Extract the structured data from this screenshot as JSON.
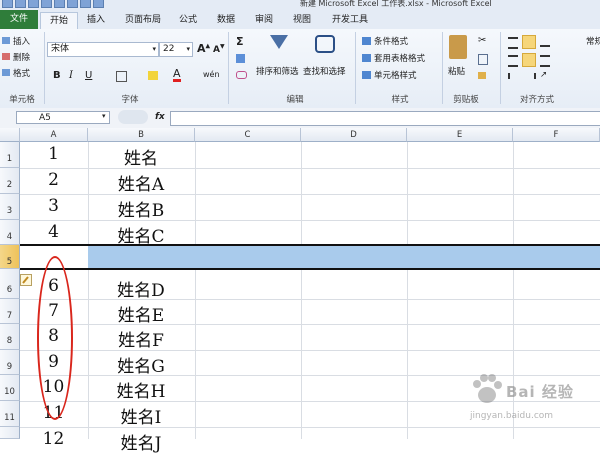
{
  "window": {
    "title": "新建 Microsoft Excel 工作表.xlsx - Microsoft Excel"
  },
  "tabs": [
    {
      "label": "文件"
    },
    {
      "label": "开始"
    },
    {
      "label": "插入"
    },
    {
      "label": "页面布局"
    },
    {
      "label": "公式"
    },
    {
      "label": "数据"
    },
    {
      "label": "审阅"
    },
    {
      "label": "视图"
    },
    {
      "label": "开发工具"
    }
  ],
  "ribbon": {
    "cells_group": {
      "insert": "插入",
      "delete": "删除",
      "format": "格式",
      "label": "单元格"
    },
    "font_group": {
      "font_name": "宋体",
      "font_size": "22",
      "label": "字体",
      "phonetic": "wén"
    },
    "editing_group": {
      "sort_filter": "排序和筛选",
      "find_select": "查找和选择",
      "label": "编辑"
    },
    "styles_group": {
      "conditional": "条件格式",
      "table_format": "套用表格格式",
      "cell_styles": "单元格样式",
      "label": "样式"
    },
    "clipboard_group": {
      "paste": "粘贴",
      "label": "剪贴板"
    },
    "alignment_group": {
      "wrap": "常规",
      "label": "对齐方式"
    }
  },
  "formula_bar": {
    "name_box": "A5",
    "fx": "fx",
    "formula": ""
  },
  "sheet": {
    "columns": [
      "A",
      "B",
      "C",
      "D",
      "E",
      "F"
    ],
    "rows": [
      {
        "num": "1",
        "a": "1",
        "b": "姓名"
      },
      {
        "num": "2",
        "a": "2",
        "b": "姓名A"
      },
      {
        "num": "3",
        "a": "3",
        "b": "姓名B"
      },
      {
        "num": "4",
        "a": "4",
        "b": "姓名C"
      },
      {
        "num": "5",
        "a": "",
        "b": ""
      },
      {
        "num": "6",
        "a": "6",
        "b": "姓名D"
      },
      {
        "num": "7",
        "a": "7",
        "b": "姓名E"
      },
      {
        "num": "8",
        "a": "8",
        "b": "姓名F"
      },
      {
        "num": "9",
        "a": "9",
        "b": "姓名G"
      },
      {
        "num": "10",
        "a": "10",
        "b": "姓名H"
      },
      {
        "num": "11",
        "a": "11",
        "b": "姓名I"
      },
      {
        "num": "12",
        "a": "12",
        "b": "姓名J"
      }
    ],
    "selected_row_color": "#a9cbec",
    "annotation_color": "#d9261c"
  },
  "watermark": {
    "main": "Bai 经验",
    "url": "jingyan.baidu.com"
  }
}
